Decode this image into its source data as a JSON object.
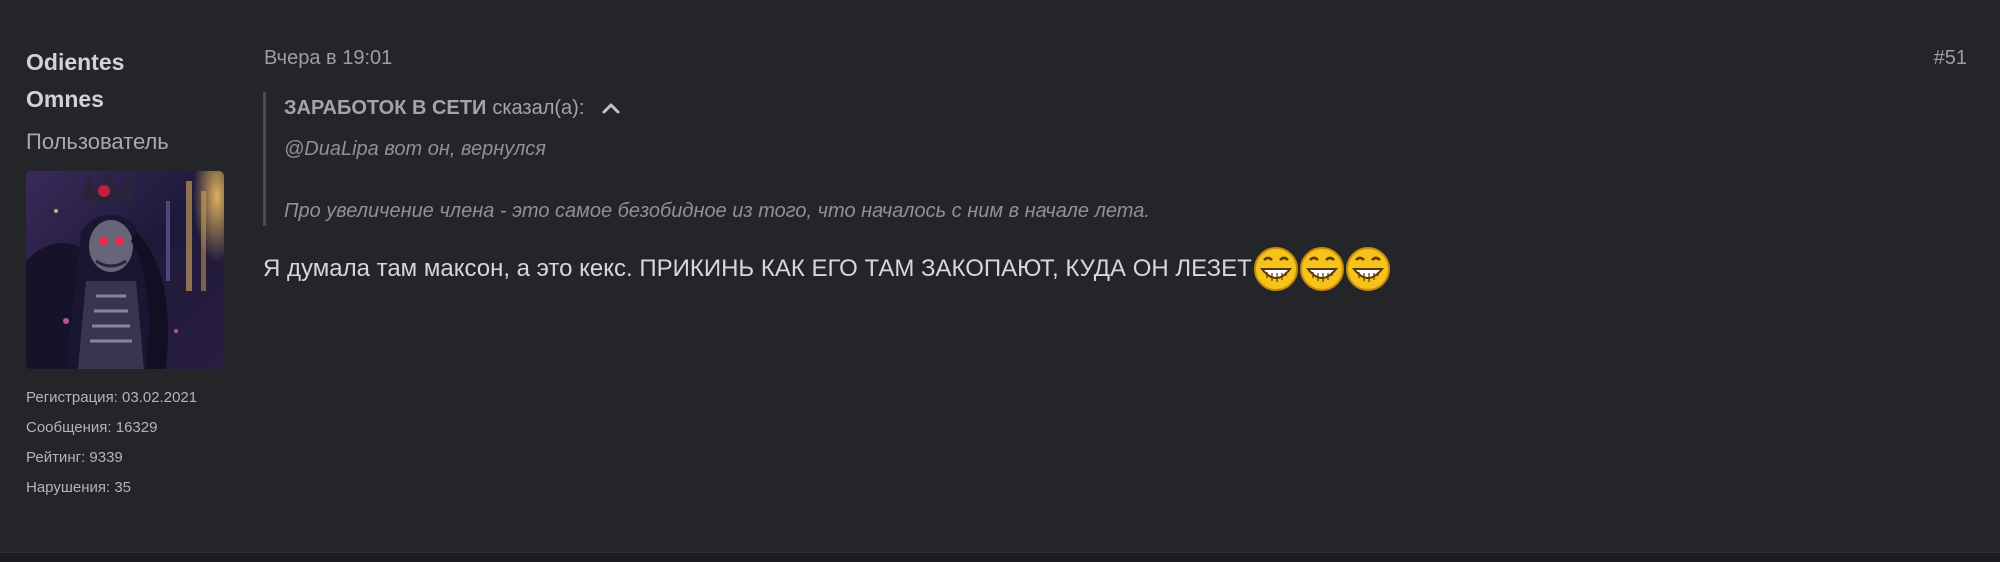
{
  "user": {
    "name": "Odientes Omnes",
    "title": "Пользователь",
    "stats": [
      "Регистрация: 03.02.2021",
      "Сообщения: 16329",
      "Рейтинг: 9339",
      "Нарушения: 35"
    ]
  },
  "post": {
    "date": "Вчера в 19:01",
    "number": "#51",
    "quote": {
      "author": "ЗАРАБОТОК В СЕТИ",
      "said": "сказал(а):",
      "toggle_icon": "chevron-up-icon",
      "lines": [
        "@DuaLipa вот он, вернулся",
        "Про увеличение члена - это самое безобидное из того, что началось с ним в начале лета."
      ]
    },
    "message": "Я думала там максон, а это кекс. ПРИКИНЬ КАК ЕГО ТАМ ЗАКОПАЮТ, КУДА ОН ЛЕЗЕТ",
    "emojis": [
      "laughing-smiley-icon",
      "laughing-smiley-icon",
      "laughing-smiley-icon"
    ]
  },
  "colors": {
    "background": "#242529",
    "text": "#d7d7da",
    "muted": "#9d9da2",
    "emoji_yellow": "#f5c31c"
  }
}
